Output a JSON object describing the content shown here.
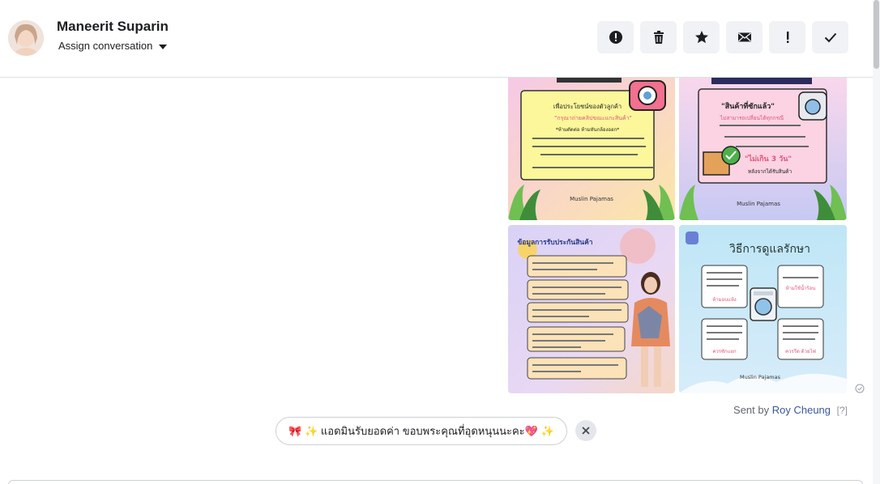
{
  "header": {
    "contact_name": "Maneerit Suparin",
    "assign_label": "Assign conversation"
  },
  "toolbar": {
    "buttons": [
      {
        "name": "report-spam-button",
        "icon": "alert-circle-icon"
      },
      {
        "name": "delete-button",
        "icon": "trash-icon"
      },
      {
        "name": "star-button",
        "icon": "star-icon"
      },
      {
        "name": "mark-unread-button",
        "icon": "envelope-icon"
      },
      {
        "name": "important-button",
        "icon": "exclamation-icon"
      },
      {
        "name": "mark-done-button",
        "icon": "check-icon"
      }
    ]
  },
  "images": {
    "tile1": {
      "line1": "เพื่อประโยชน์ของตัวลูกค้า",
      "line2": "\"กรุณาถ่ายคลิปขณะแกะสินค้า\"",
      "line3": "*ห้ามตัดต่อ ห้ามหันกล้องออก*",
      "footer": "Muslin Pajamas"
    },
    "tile2": {
      "title": "\"สินค้าที่ซักแล้ว\"",
      "line2": "ไม่สามารถเปลี่ยนได้ทุกกรณี",
      "big": "\"ไม่เกิน 3 วัน\"",
      "line4": "หลังจากได้รับสินค้า",
      "footer": "Muslin Pajamas"
    },
    "tile3": {
      "title": "ข้อมูลการรับประกันสินค้า"
    },
    "tile4": {
      "title": "วิธีการดูแลรักษา",
      "label1": "ห้ามใช้น้ำร้อน",
      "label2": "ห้ามอบแห้ง",
      "label3": "ควรซักแยก",
      "label4": "ควรรีด ด้วยไฟ",
      "footer": "Muslin Pajamas"
    }
  },
  "message": {
    "sent_by_prefix": "Sent by",
    "sent_by_name": "Roy Cheung",
    "help_mark": "[?]",
    "reply_text": "🎀 ✨ แอดมินรับยอดค่า ขอบพระคุณที่อุดหนุนนะคะ💖 ✨"
  },
  "colors": {
    "accent_link": "#385898",
    "toolbar_bg": "#f0f2f5"
  }
}
